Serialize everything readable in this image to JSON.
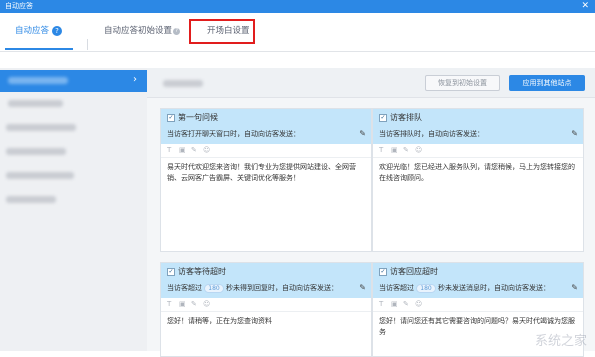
{
  "window": {
    "title": "自动应答",
    "close_glyph": "✕"
  },
  "tabs": [
    {
      "label": "自动应答",
      "badge": "?"
    },
    {
      "label": "自动应答初始设置",
      "badge": "?"
    },
    {
      "label": "开场白设置"
    }
  ],
  "sidebar": {
    "chevron": "›"
  },
  "toolbar": {
    "restore_label": "恢复到初始设置",
    "apply_label": "应用到其他站点"
  },
  "cards": [
    {
      "title": "第一句问候",
      "desc": "当访客打开聊天窗口时，自动向访客发送：",
      "tool_icons": [
        "T",
        "▣",
        "✎",
        "☺"
      ],
      "body": "易天时代欢迎您来咨询！我们专业为您提供网站建设、全网营销、云网客广告霸屏、关键词优化等服务！"
    },
    {
      "title": "访客排队",
      "desc": "当访客排队时，自动向访客发送：",
      "tool_icons": [
        "T",
        "▣",
        "✎",
        "☺"
      ],
      "body": "欢迎光临！您已经进入服务队列，请您稍候，马上为您转接您的在线咨询顾问。"
    },
    {
      "title": "访客等待超时",
      "desc_pre": "当访客超过",
      "desc_value": "180",
      "desc_post": "秒未得到回复时，自动向访客发送：",
      "tool_icons": [
        "T",
        "▣",
        "✎",
        "☺"
      ],
      "body": "您好！请稍等，正在为您查询资料"
    },
    {
      "title": "访客回应超时",
      "desc_pre": "当访客超过",
      "desc_value": "180",
      "desc_post": "秒未发送消息时，自动向访客发送：",
      "tool_icons": [
        "T",
        "▣",
        "✎",
        "☺"
      ],
      "body": "您好！请问您还有其它需要咨询的问题吗？易天时代竭诚为您服务"
    }
  ],
  "watermark": "系统之家"
}
